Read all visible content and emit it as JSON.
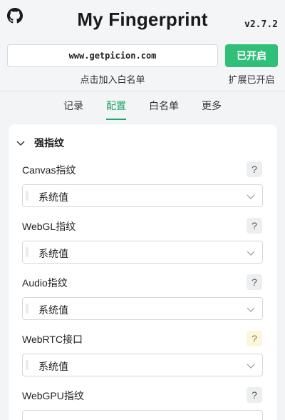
{
  "header": {
    "title": "My Fingerprint",
    "version": "v2.7.2",
    "domain": "www.getpicion.com",
    "enable_button": "已开启",
    "whitelist_link": "点击加入白名单",
    "extension_status": "扩展已开启"
  },
  "tabs": [
    {
      "label": "记录",
      "active": false
    },
    {
      "label": "配置",
      "active": true
    },
    {
      "label": "白名单",
      "active": false
    },
    {
      "label": "更多",
      "active": false
    }
  ],
  "section": {
    "title": "强指纹",
    "expanded": true,
    "fields": [
      {
        "label": "Canvas指纹",
        "value": "系统值",
        "help": "?",
        "help_style": "normal"
      },
      {
        "label": "WebGL指纹",
        "value": "系统值",
        "help": "?",
        "help_style": "normal"
      },
      {
        "label": "Audio指纹",
        "value": "系统值",
        "help": "?",
        "help_style": "normal"
      },
      {
        "label": "WebRTC接口",
        "value": "系统值",
        "help": "?",
        "help_style": "warn"
      },
      {
        "label": "WebGPU指纹",
        "value": "",
        "help": "?",
        "help_style": "normal"
      }
    ]
  },
  "colors": {
    "accent": "#2fbf78",
    "tab_active": "#1da66a",
    "background": "#f3f4f6"
  }
}
